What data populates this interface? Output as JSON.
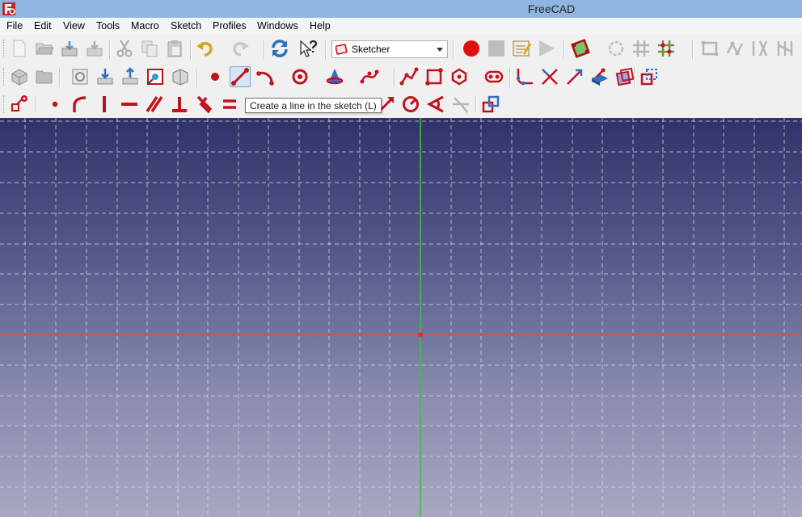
{
  "window": {
    "title": "FreeCAD"
  },
  "menubar": {
    "items": [
      "File",
      "Edit",
      "View",
      "Tools",
      "Macro",
      "Sketch",
      "Profiles",
      "Windows",
      "Help"
    ]
  },
  "workbench_selector": {
    "selected": "Sketcher"
  },
  "tooltip": {
    "text": "Create a line in the sketch (L)"
  },
  "colors": {
    "sketch_accent": "#c1121f",
    "axis_vertical": "#3fbf3f",
    "axis_horizontal": "#e0503c",
    "origin_point": "#ff2020",
    "viewport_top": "#31326a",
    "viewport_bottom": "#a7a8c1",
    "titlebar": "#8fb5e0"
  },
  "icons": {
    "toolbar_row1": [
      "new-file-icon",
      "open-file-icon",
      "save-file-icon",
      "save-as-icon",
      "cut-icon",
      "copy-icon",
      "paste-icon",
      "undo-icon",
      "redo-icon",
      "refresh-icon",
      "whats-this-icon",
      "record-macro-icon",
      "stop-macro-icon",
      "macro-editor-icon",
      "run-macro-icon",
      "validate-sketch-icon",
      "show-sketch-points-icon",
      "grid-snap-icon",
      "constraint-snap-icon",
      "sketch-mirror-icon",
      "sketch-copy-icon",
      "sketch-array-icon",
      "sketch-symmetry-icon"
    ],
    "toolbar_row2": [
      "part-box-icon",
      "open-folder-icon",
      "new-sketch-icon",
      "edit-sketch-icon",
      "leave-sketch-icon",
      "view-sketch-icon",
      "map-sketch-icon",
      "point-icon",
      "line-icon",
      "arc-icon",
      "circle-icon",
      "conic-icon",
      "bspline-icon",
      "polyline-icon",
      "rectangle-icon",
      "polygon-icon",
      "slot-icon",
      "fillet-icon",
      "trim-icon",
      "extend-icon",
      "external-geometry-icon",
      "carbon-copy-icon",
      "construction-mode-icon"
    ],
    "toolbar_row3": [
      "constraint-select-icon",
      "coincident-constraint-icon",
      "point-on-object-icon",
      "vertical-constraint-icon",
      "horizontal-constraint-icon",
      "parallel-constraint-icon",
      "perpendicular-constraint-icon",
      "tangent-constraint-icon",
      "equal-constraint-icon",
      "distance-constraint-icon",
      "radius-constraint-icon",
      "angle-constraint-icon",
      "snell-law-icon",
      "toggle-driving-icon"
    ]
  }
}
